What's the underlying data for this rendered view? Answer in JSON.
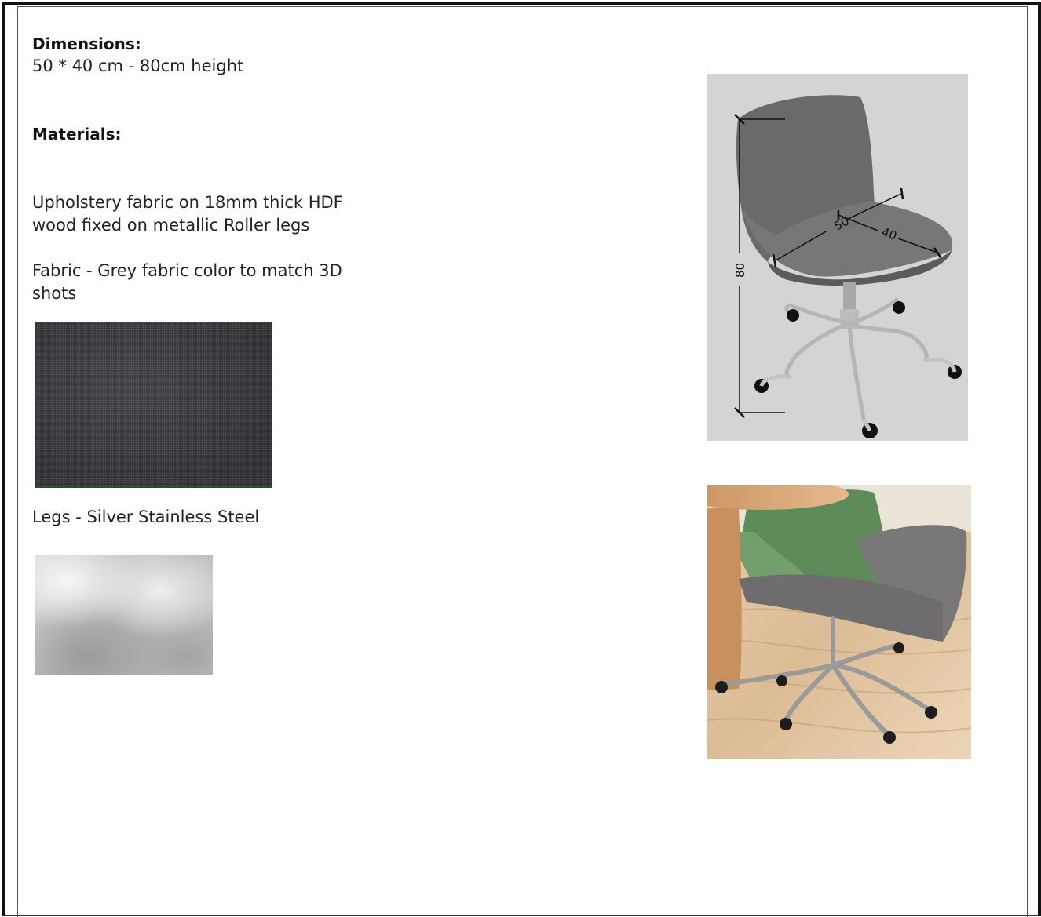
{
  "dimensions": {
    "heading": "Dimensions:",
    "value": "50 * 40 cm - 80cm height"
  },
  "materials": {
    "heading": "Materials:",
    "description_line1": "Upholstery fabric on 18mm thick HDF",
    "description_line2": "wood fixed on metallic Roller  legs",
    "fabric_line1": "Fabric - Grey fabric color to match 3D",
    "fabric_line2": "shots",
    "legs": "Legs - Silver Stainless Steel"
  },
  "diagram": {
    "label_width": "50",
    "label_depth": "40",
    "label_height": "80"
  },
  "colors": {
    "fabric_swatch": "#3b3d40",
    "chair_shell": "#6b6b6b",
    "diagram_background": "#d4d4d4",
    "steel": "#c4c4c4"
  }
}
